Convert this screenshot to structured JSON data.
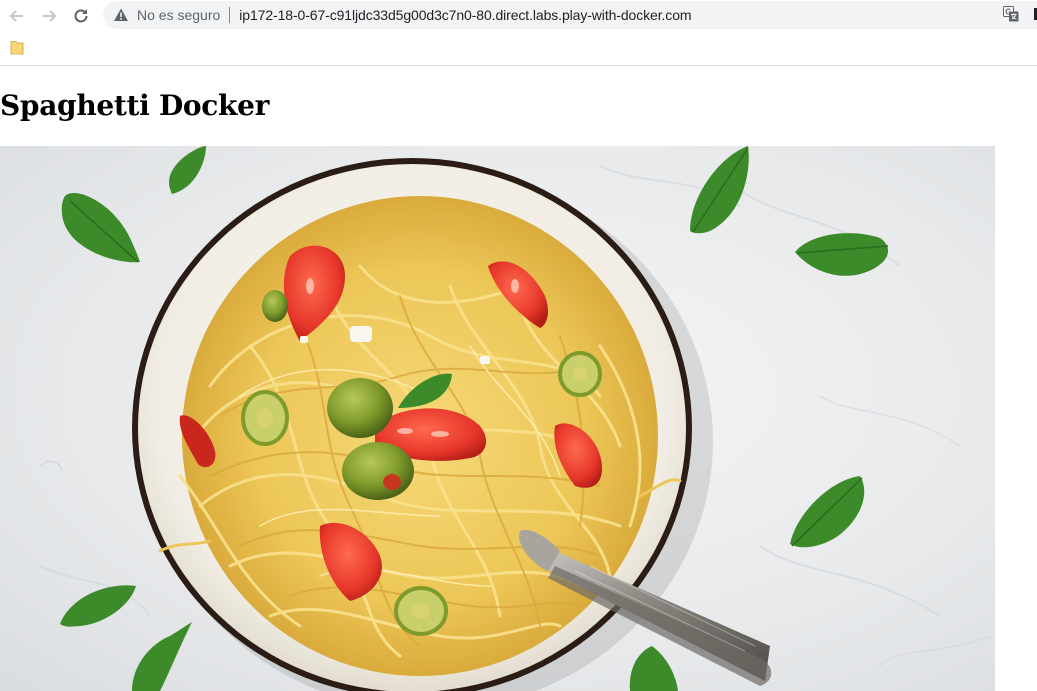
{
  "browser": {
    "security_label": "No es seguro",
    "url": "ip172-18-0-67-c91ljdc33d5g00d3c7n0-80.direct.labs.play-with-docker.com"
  },
  "page": {
    "title": "Spaghetti Docker"
  },
  "icons": {
    "back": "arrow-left-icon",
    "forward": "arrow-right-icon",
    "reload": "reload-icon",
    "security": "warning-triangle-icon",
    "translate": "translate-icon",
    "bookmark": "folder-icon"
  },
  "colors": {
    "omnibox_bg": "#f1f3f4",
    "pasta": "#f2cf62",
    "tomato": "#e6362a",
    "olive": "#7f9b2c",
    "basil": "#3d8a2a",
    "marble": "#eceef0"
  }
}
